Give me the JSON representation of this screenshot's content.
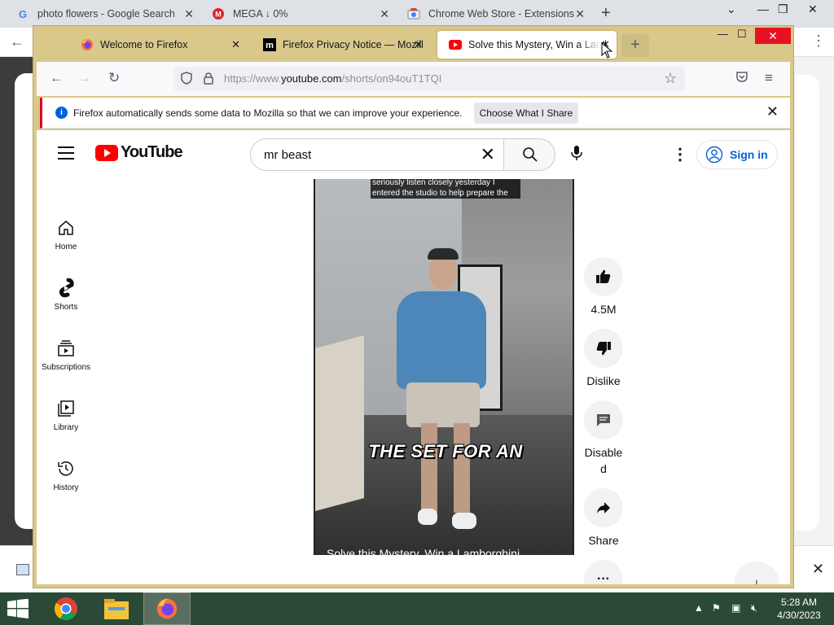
{
  "chrome": {
    "tabs": [
      {
        "label": "photo flowers - Google Search",
        "icon": "google-icon"
      },
      {
        "label": "MEGA ↓ 0%",
        "icon": "mega-icon"
      },
      {
        "label": "Chrome Web Store - Extensions",
        "icon": "chrome-web-store-icon"
      }
    ],
    "new_tab": "+",
    "close": "✕"
  },
  "firefox": {
    "tabs": [
      {
        "label": "Welcome to Firefox",
        "icon": "firefox-icon"
      },
      {
        "label": "Firefox Privacy Notice — Mozilla",
        "icon": "mozilla-m-icon"
      },
      {
        "label": "Solve this Mystery, Win a Lamborghini",
        "icon": "youtube-icon",
        "active": true
      }
    ],
    "new_tab": "+",
    "url_prefix": "https://www.",
    "url_domain": "youtube.com",
    "url_path": "/shorts/on94ouT1TQI",
    "notification": {
      "message": "Firefox automatically sends some data to Mozilla so that we can improve your experience.",
      "button": "Choose What I Share"
    }
  },
  "youtube": {
    "logo_text": "YouTube",
    "search_query": "mr beast",
    "sign_in": "Sign in",
    "sidebar": [
      {
        "label": "Home",
        "icon": "home-icon"
      },
      {
        "label": "Shorts",
        "icon": "shorts-icon"
      },
      {
        "label": "Subscriptions",
        "icon": "subscriptions-icon"
      },
      {
        "label": "Library",
        "icon": "library-icon"
      },
      {
        "label": "History",
        "icon": "history-icon"
      }
    ],
    "video": {
      "caption_top": "seriously listen closely yesterday I entered the studio to help prepare the",
      "caption_big": "THE SET FOR AN",
      "title": "Solve this Mystery, Win a Lamborghini"
    },
    "actions": {
      "like_count": "4.5M",
      "dislike": "Dislike",
      "comments": "Disabled",
      "share": "Share"
    }
  },
  "taskbar": {
    "time": "5:28 AM",
    "date": "4/30/2023"
  }
}
